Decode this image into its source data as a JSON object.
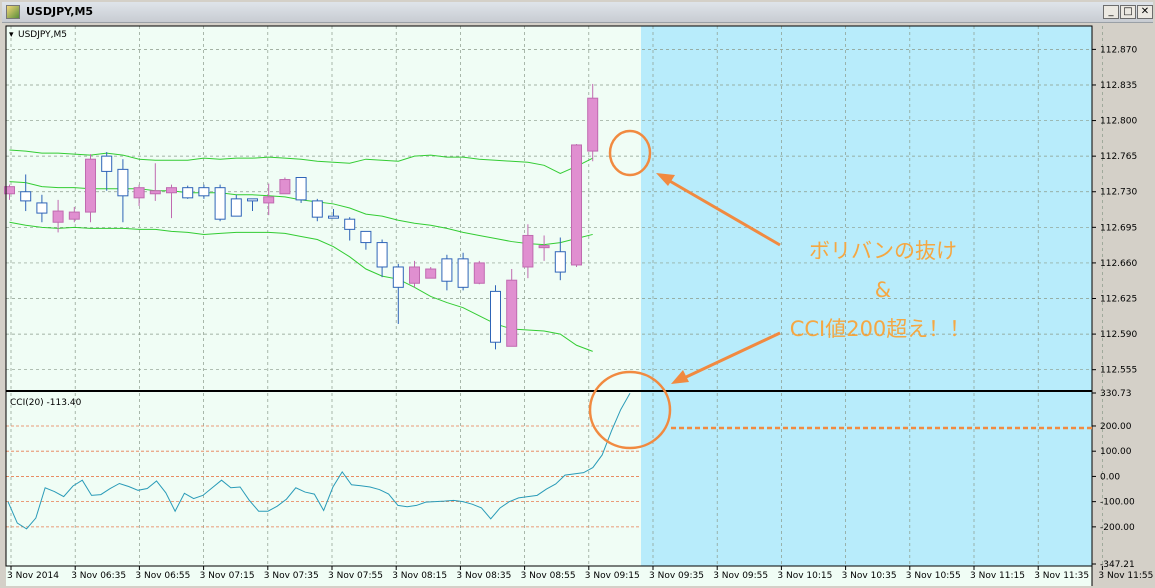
{
  "window": {
    "title": "USDJPY,M5"
  },
  "price_pane": {
    "label": "USDJPY,M5",
    "price_labels": [
      "112.870",
      "112.835",
      "112.800",
      "112.765",
      "112.730",
      "112.695",
      "112.660",
      "112.625",
      "112.590",
      "112.555"
    ]
  },
  "cci_pane": {
    "label": "CCI(20) -113.40",
    "level_labels": [
      "330.73",
      "200.00",
      "100.00",
      "0.00",
      "-100.00",
      "-200.00",
      "-347.21"
    ]
  },
  "time_labels": [
    "3 Nov 2014",
    "3 Nov 06:35",
    "3 Nov 06:55",
    "3 Nov 07:15",
    "3 Nov 07:35",
    "3 Nov 07:55",
    "3 Nov 08:15",
    "3 Nov 08:35",
    "3 Nov 08:55",
    "3 Nov 09:15",
    "3 Nov 09:35",
    "3 Nov 09:55",
    "3 Nov 10:15",
    "3 Nov 10:35",
    "3 Nov 10:55",
    "3 Nov 11:15",
    "3 Nov 11:35",
    "3 Nov 11:55"
  ],
  "annotations": {
    "line1": "ボリバンの抜け",
    "line2": "&",
    "line3": "CCI値200超え！！"
  },
  "colors": {
    "bg": "#f0fdf5",
    "future_bg": "#b8ecfb",
    "bull": "#e08fd0",
    "bear": "#ffffff",
    "candle_outline": "#2f64b8",
    "bands": "#33cc33",
    "cci_line": "#2a9bb8",
    "level_line": "#e87c50",
    "annotation": "#f5a742"
  },
  "chart_data": [
    {
      "type": "candlestick",
      "title": "USDJPY,M5",
      "ylim": [
        112.536,
        112.893
      ],
      "candles": [
        {
          "open": 112.728,
          "close": 112.735,
          "high": 112.737,
          "low": 112.722
        },
        {
          "open": 112.73,
          "close": 112.721,
          "high": 112.747,
          "low": 112.711
        },
        {
          "open": 112.719,
          "close": 112.709,
          "high": 112.727,
          "low": 112.7
        },
        {
          "open": 112.7,
          "close": 112.711,
          "high": 112.722,
          "low": 112.69
        },
        {
          "open": 112.703,
          "close": 112.71,
          "high": 112.715,
          "low": 112.7
        },
        {
          "open": 112.71,
          "close": 112.762,
          "high": 112.767,
          "low": 112.7
        },
        {
          "open": 112.765,
          "close": 112.75,
          "high": 112.769,
          "low": 112.731
        },
        {
          "open": 112.752,
          "close": 112.726,
          "high": 112.762,
          "low": 112.7
        },
        {
          "open": 112.724,
          "close": 112.734,
          "high": 112.737,
          "low": 112.716
        },
        {
          "open": 112.728,
          "close": 112.731,
          "high": 112.758,
          "low": 112.721
        },
        {
          "open": 112.729,
          "close": 112.734,
          "high": 112.737,
          "low": 112.704
        },
        {
          "open": 112.734,
          "close": 112.724,
          "high": 112.736,
          "low": 112.723
        },
        {
          "open": 112.734,
          "close": 112.726,
          "high": 112.737,
          "low": 112.723
        },
        {
          "open": 112.734,
          "close": 112.703,
          "high": 112.737,
          "low": 112.701
        },
        {
          "open": 112.723,
          "close": 112.706,
          "high": 112.727,
          "low": 112.706
        },
        {
          "open": 112.723,
          "close": 112.721,
          "high": 112.722,
          "low": 112.711
        },
        {
          "open": 112.719,
          "close": 112.725,
          "high": 112.738,
          "low": 112.707
        },
        {
          "open": 112.728,
          "close": 112.742,
          "high": 112.744,
          "low": 112.728
        },
        {
          "open": 112.744,
          "close": 112.722,
          "high": 112.744,
          "low": 112.719
        },
        {
          "open": 112.721,
          "close": 112.705,
          "high": 112.723,
          "low": 112.701
        },
        {
          "open": 112.706,
          "close": 112.704,
          "high": 112.713,
          "low": 112.706
        },
        {
          "open": 112.703,
          "close": 112.693,
          "high": 112.705,
          "low": 112.682
        },
        {
          "open": 112.691,
          "close": 112.68,
          "high": 112.691,
          "low": 112.673
        },
        {
          "open": 112.68,
          "close": 112.656,
          "high": 112.683,
          "low": 112.646
        },
        {
          "open": 112.656,
          "close": 112.636,
          "high": 112.659,
          "low": 112.6
        },
        {
          "open": 112.64,
          "close": 112.656,
          "high": 112.662,
          "low": 112.636
        },
        {
          "open": 112.645,
          "close": 112.654,
          "high": 112.656,
          "low": 112.646
        },
        {
          "open": 112.664,
          "close": 112.642,
          "high": 112.668,
          "low": 112.633
        },
        {
          "open": 112.664,
          "close": 112.636,
          "high": 112.67,
          "low": 112.633
        },
        {
          "open": 112.64,
          "close": 112.66,
          "high": 112.662,
          "low": 112.639
        },
        {
          "open": 112.632,
          "close": 112.582,
          "high": 112.638,
          "low": 112.575
        },
        {
          "open": 112.578,
          "close": 112.643,
          "high": 112.654,
          "low": 112.578
        },
        {
          "open": 112.656,
          "close": 112.687,
          "high": 112.698,
          "low": 112.645
        },
        {
          "open": 112.675,
          "close": 112.677,
          "high": 112.687,
          "low": 112.662
        },
        {
          "open": 112.671,
          "close": 112.651,
          "high": 112.685,
          "low": 112.643
        },
        {
          "open": 112.658,
          "close": 112.776,
          "high": 112.777,
          "low": 112.656
        },
        {
          "open": 112.77,
          "close": 112.822,
          "high": 112.836,
          "low": 112.76
        }
      ],
      "bands": {
        "upper": [
          112.771,
          112.77,
          112.768,
          112.768,
          112.767,
          112.766,
          112.768,
          112.766,
          112.762,
          112.761,
          112.761,
          112.761,
          112.763,
          112.762,
          112.763,
          112.763,
          112.764,
          112.763,
          112.762,
          112.76,
          112.759,
          112.758,
          112.762,
          112.761,
          112.76,
          112.765,
          112.766,
          112.764,
          112.764,
          112.762,
          112.761,
          112.76,
          112.759,
          112.756,
          112.748,
          112.755,
          112.763
        ],
        "middle": [
          112.74,
          112.739,
          112.735,
          112.734,
          112.734,
          112.733,
          112.733,
          112.733,
          112.733,
          112.731,
          112.731,
          112.729,
          112.729,
          112.729,
          112.727,
          112.727,
          112.726,
          112.725,
          112.722,
          112.72,
          112.718,
          112.714,
          112.708,
          112.706,
          112.702,
          112.699,
          112.697,
          112.694,
          112.69,
          112.687,
          112.684,
          112.681,
          112.679,
          112.678,
          112.68,
          112.684,
          112.688
        ],
        "lower": [
          112.7,
          112.697,
          112.695,
          112.694,
          112.695,
          112.694,
          112.694,
          112.694,
          112.693,
          112.693,
          112.691,
          112.69,
          112.688,
          112.689,
          112.69,
          112.69,
          112.69,
          112.689,
          112.686,
          112.683,
          112.676,
          112.666,
          112.654,
          112.647,
          112.644,
          112.636,
          112.627,
          112.621,
          112.616,
          112.608,
          112.6,
          112.595,
          112.594,
          112.593,
          112.59,
          112.579,
          112.573
        ]
      }
    },
    {
      "type": "line",
      "title": "CCI(20) -113.40",
      "ylim": [
        -347.21,
        330.73
      ],
      "levels": [
        200,
        100,
        0,
        -100,
        -200
      ],
      "series": [
        {
          "values": [
            -100,
            -185,
            -208,
            -165,
            -45,
            -60,
            -80,
            -38,
            -15,
            -75,
            -72,
            -48,
            -28,
            -40,
            -55,
            -48,
            -18,
            -65,
            -138,
            -67,
            -88,
            -75,
            -45,
            -15,
            -45,
            -42,
            -95,
            -138,
            -138,
            -118,
            -90,
            -45,
            -62,
            -70,
            -135,
            -42,
            18,
            -33,
            -37,
            -42,
            -52,
            -70,
            -115,
            -120,
            -115,
            -102,
            -100,
            -98,
            -95,
            -100,
            -110,
            -125,
            -168,
            -125,
            -100,
            -85,
            -80,
            -75,
            -50,
            -30,
            5,
            10,
            15,
            35,
            85,
            180,
            265,
            330
          ]
        }
      ]
    }
  ]
}
